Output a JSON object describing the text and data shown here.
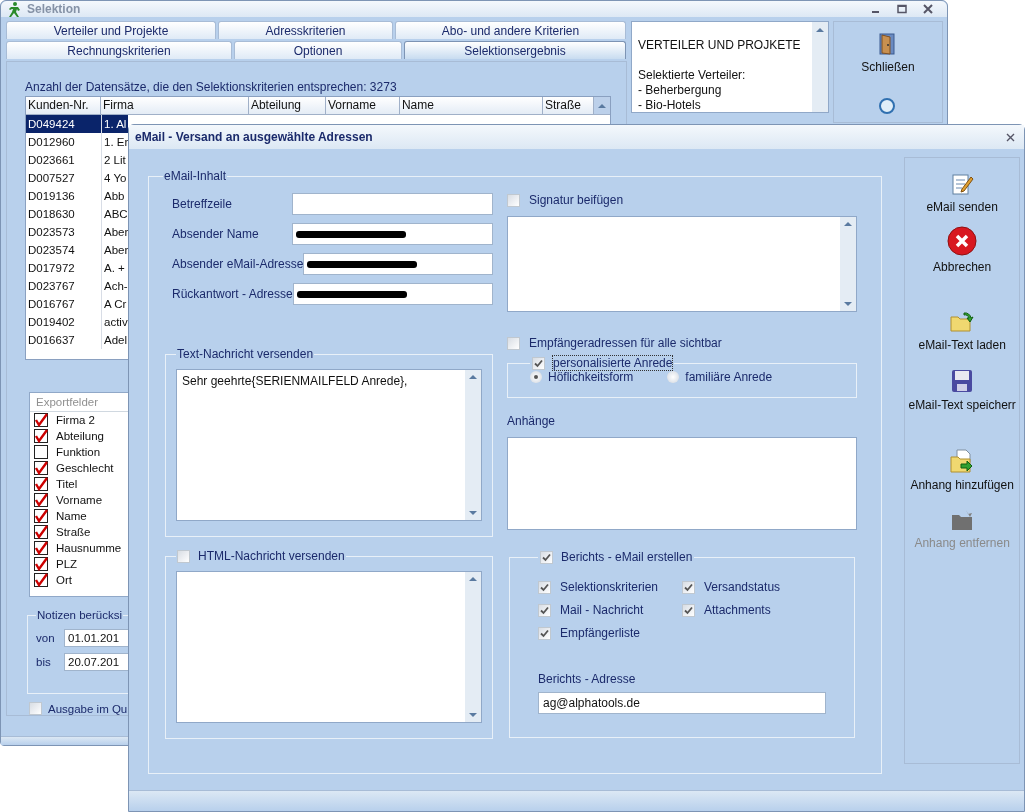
{
  "main_window": {
    "title": "Selektion",
    "tab_rows": [
      [
        {
          "label": "Verteiler und Projekte",
          "selected": false
        },
        {
          "label": "Adresskriterien",
          "selected": false
        },
        {
          "label": "Abo- und andere Kriterien",
          "selected": false
        }
      ],
      [
        {
          "label": "Rechnungskriterien",
          "selected": false
        },
        {
          "label": "Optionen",
          "selected": false
        },
        {
          "label": "Selektionsergebnis",
          "selected": true
        }
      ]
    ],
    "record_count": "Anzahl der Datensätze, die den Selektionskriterien entsprechen: 3273",
    "table": {
      "columns": [
        "Kunden-Nr.",
        "Firma",
        "Abteilung",
        "Vorname",
        "Name",
        "Straße"
      ],
      "rows": [
        {
          "cells": [
            "D049424",
            "1. Al"
          ],
          "selected": true
        },
        {
          "cells": [
            "D012960",
            "1. Er"
          ],
          "selected": false
        },
        {
          "cells": [
            "D023661",
            "2 Lit"
          ],
          "selected": false
        },
        {
          "cells": [
            "D007527",
            "4 Yo"
          ],
          "selected": false
        },
        {
          "cells": [
            "D019136",
            "Abb"
          ],
          "selected": false
        },
        {
          "cells": [
            "D018630",
            "ABC"
          ],
          "selected": false
        },
        {
          "cells": [
            "D023573",
            "Aber"
          ],
          "selected": false
        },
        {
          "cells": [
            "D023574",
            "Aber"
          ],
          "selected": false
        },
        {
          "cells": [
            "D017972",
            "A. +"
          ],
          "selected": false
        },
        {
          "cells": [
            "D023767",
            "Ach-"
          ],
          "selected": false
        },
        {
          "cells": [
            "D016767",
            "A Cr"
          ],
          "selected": false
        },
        {
          "cells": [
            "D019402",
            "activ"
          ],
          "selected": false
        },
        {
          "cells": [
            "D016637",
            "Adel"
          ],
          "selected": false
        }
      ]
    },
    "info_panel": {
      "heading": "VERTEILER UND PROJKETE",
      "lines": [
        "Selektierte Verteiler:",
        "- Beherbergung",
        "- Bio-Hotels"
      ]
    },
    "buttons": [
      {
        "label": "Schließen"
      }
    ],
    "export_fields": {
      "title": "Exportfelder",
      "items": [
        {
          "label": "Firma 2",
          "checked": true
        },
        {
          "label": "Abteilung",
          "checked": true
        },
        {
          "label": "Funktion",
          "checked": false
        },
        {
          "label": "Geschlecht",
          "checked": true
        },
        {
          "label": "Titel",
          "checked": true
        },
        {
          "label": "Vorname",
          "checked": true
        },
        {
          "label": "Name",
          "checked": true
        },
        {
          "label": "Straße",
          "checked": true
        },
        {
          "label": "Hausnumme",
          "checked": true
        },
        {
          "label": "PLZ",
          "checked": true
        },
        {
          "label": "Ort",
          "checked": true
        }
      ]
    },
    "notes": {
      "title": "Notizen berücksi",
      "fields": [
        {
          "label": "von",
          "value": "01.01.201"
        },
        {
          "label": "bis",
          "value": "20.07.201"
        }
      ]
    },
    "output_option": {
      "label": "Ausgabe im Qu",
      "checked": false
    }
  },
  "dialog": {
    "title": "eMail - Versand an ausgewählte Adressen",
    "content_group": "eMail-Inhalt",
    "fields": [
      {
        "label": "Betreffzeile",
        "redacted": false
      },
      {
        "label": "Absender Name",
        "redacted": true
      },
      {
        "label": "Absender eMail-Adresse",
        "redacted": true
      },
      {
        "label": "Rückantwort - Adresse",
        "redacted": true
      }
    ],
    "signature": {
      "label": "Signatur beifügen",
      "checked": false
    },
    "text_message": {
      "title": "Text-Nachricht versenden",
      "value": "Sehr geehrte{SERIENMAILFELD Anrede},"
    },
    "html_message": {
      "label": "HTML-Nachricht versenden",
      "checked": false
    },
    "recipients_visible": {
      "label": "Empfängeradressen für alle sichtbar",
      "checked": false
    },
    "salutation": {
      "label": "personalisierte Anrede",
      "checked": true,
      "options": [
        {
          "label": "Höflichkeitsform",
          "selected": true
        },
        {
          "label": "familiäre Anrede",
          "selected": false
        }
      ]
    },
    "attachments_label": "Anhänge",
    "report": {
      "label": "Berichts - eMail erstellen",
      "checked": true,
      "options": [
        {
          "label": "Selektionskriterien",
          "checked": true
        },
        {
          "label": "Versandstatus",
          "checked": true
        },
        {
          "label": "Mail - Nachricht",
          "checked": true
        },
        {
          "label": "Attachments",
          "checked": true
        },
        {
          "label": "Empfängerliste",
          "checked": true
        }
      ],
      "address_label": "Berichts - Adresse",
      "address": "ag@alphatools.de"
    },
    "toolbar": [
      {
        "label": "eMail senden",
        "disabled": false
      },
      {
        "label": "Abbrechen",
        "disabled": false
      },
      {
        "label": "eMail-Text laden",
        "disabled": false
      },
      {
        "label": "eMail-Text speicherr",
        "disabled": false
      },
      {
        "label": "Anhang hinzufügen",
        "disabled": false
      },
      {
        "label": "Anhang entfernen",
        "disabled": true
      }
    ]
  }
}
